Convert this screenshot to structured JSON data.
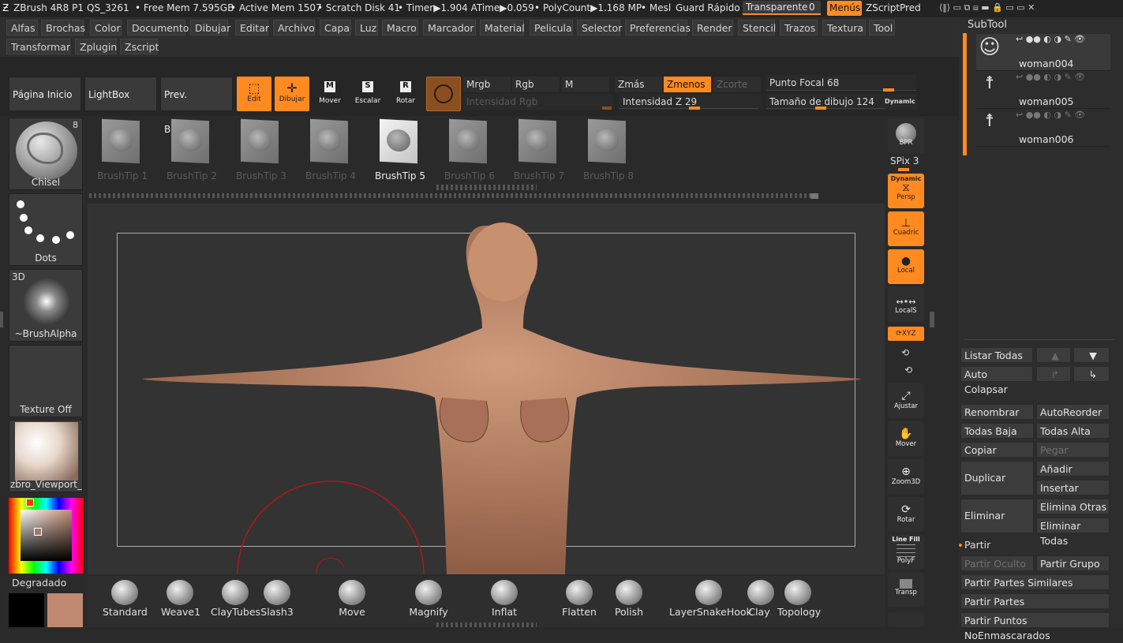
{
  "titlebar": {
    "app": "ZBrush 4R8 P1",
    "project": "QS_3261",
    "freemem": "• Free Mem 7.595GB",
    "activemem": "• Active Mem 1507",
    "scratch": "• Scratch Disk 41",
    "timer": "• Timer▶1.904 ATime▶0.059",
    "poly": "• PolyCount▶1.168 MP",
    "mesh": "• Mesl",
    "guard": "Guard Rápido",
    "transparent": "Transparente",
    "transparent_val": "0",
    "menus": "Menús",
    "zscript": "ZScriptPred"
  },
  "menu_row1": [
    "Alfas",
    "Brochas",
    "Color",
    "Documento",
    "Dibujar",
    "Editar",
    "Archivo",
    "Capa",
    "Luz",
    "Macro",
    "Marcador",
    "Material",
    "Pelicula",
    "Selector",
    "Preferencias",
    "Render",
    "Stencil",
    "Trazos",
    "Textura",
    "Tool"
  ],
  "menu_row2": [
    "Transformar",
    "Zplugin",
    "Zscript"
  ],
  "toolbar": {
    "home": "Página Inicio",
    "lightbox": "LightBox",
    "boolean": "Prev. Booleana",
    "edit": "Edit",
    "draw": "Dibujar",
    "move": "Mover",
    "scale": "Escalar",
    "rotate": "Rotar",
    "mrgb": "Mrgb",
    "rgb": "Rgb",
    "m": "M",
    "rgb_int": "Intensidad Rgb",
    "zadd": "Zmás",
    "zsub": "Zmenos",
    "zcut": "Zcorte",
    "z_int_label": "Intensidad Z",
    "z_int": "29",
    "focal_label": "Punto Focal",
    "focal": "68",
    "draw_size_label": "Tamaño de dibujo",
    "draw_size": "124",
    "dynamic": "Dynamic"
  },
  "left_panel": {
    "brush": "Chisel",
    "brush_count": "8",
    "stroke": "Dots",
    "alpha_tag": "3D",
    "alpha": "~BrushAlpha",
    "texture": "Texture Off",
    "material": "zbro_Viewport_S",
    "gradient": "Degradado"
  },
  "brush_tips": [
    "BrushTip 1",
    "BrushTip 2",
    "BrushTip 3",
    "BrushTip 4",
    "BrushTip 5",
    "BrushTip 6",
    "BrushTip 7",
    "BrushTip 8"
  ],
  "selected_tip": "BrushTip 5",
  "right_shelf": {
    "bpr": "BPR",
    "spix_label": "SPix",
    "spix": "3",
    "persp": "Persp",
    "persp_top": "Dynamic",
    "floor": "Cuadric",
    "local": "Local",
    "locals": "LocalS",
    "xyz": "XYZ",
    "frame": "Ajustar",
    "move": "Mover",
    "zoom": "Zoom3D",
    "rotate": "Rotar",
    "linefill": "Line Fill",
    "polyf": "PolyF",
    "transp": "Transp"
  },
  "subtool": {
    "title": "SubTool",
    "items": [
      "woman004",
      "woman005",
      "woman006"
    ],
    "list_all": "Listar Todas",
    "auto_collapse": "Auto Colapsar",
    "rename": "Renombrar",
    "autoreorder": "AutoReorder",
    "all_low": "Todas Baja",
    "all_high": "Todas Alta",
    "copy": "Copiar",
    "paste": "Pegar",
    "duplicate": "Duplicar",
    "add": "Añadir",
    "insert": "Insertar",
    "delete": "Eliminar",
    "delete_other": "Elimina Otras",
    "delete_all": "Eliminar Todas",
    "split": "Partir",
    "split_hidden": "Partir Oculto",
    "split_group": "Partir Grupo",
    "split_similar": "Partir Partes Similares",
    "split_parts": "Partir Partes",
    "split_unmasked": "Partir Puntos NoEnmascarados"
  },
  "bottom_brushes": [
    "Standard",
    "Weave1",
    "ClayTubes",
    "Slash3",
    "Move",
    "Magnify",
    "Inflat",
    "Flatten",
    "Polish",
    "LayerSnakeHook",
    "Clay",
    "Topology"
  ],
  "colors": {
    "accent": "#ff8a1f",
    "skin": "#b98569",
    "bg": "#2a2a2a",
    "secondary_color": "#c08a72"
  }
}
